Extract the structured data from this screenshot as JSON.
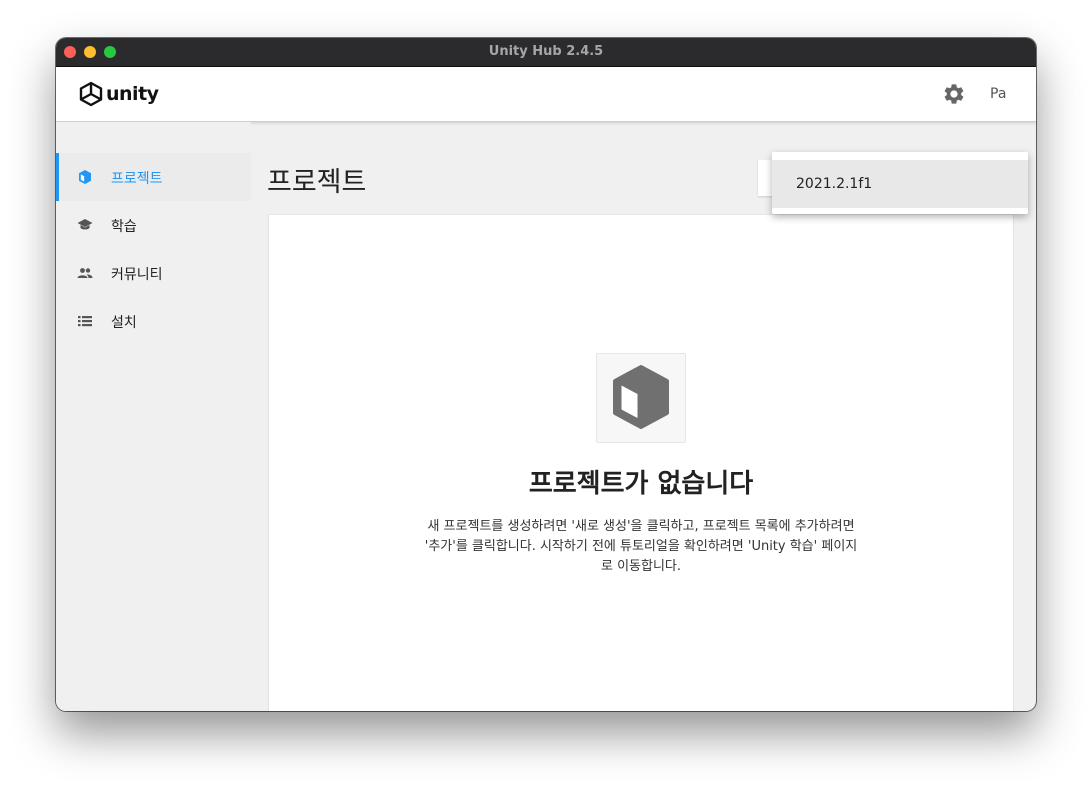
{
  "window": {
    "title": "Unity Hub 2.4.5"
  },
  "header": {
    "logo_text": "unity",
    "account_label": "Pa"
  },
  "sidebar": {
    "items": [
      {
        "label": "프로젝트",
        "icon": "cube-icon"
      },
      {
        "label": "학습",
        "icon": "graduation-cap-icon"
      },
      {
        "label": "커뮤니티",
        "icon": "people-icon"
      },
      {
        "label": "설치",
        "icon": "list-icon"
      }
    ]
  },
  "main": {
    "title": "프로젝트",
    "empty_state": {
      "title": "프로젝트가 없습니다",
      "description": "새 프로젝트를 생성하려면 '새로 생성'을 클릭하고, 프로젝트 목록에 추가하려면 '추가'를 클릭합니다. 시작하기 전에 튜토리얼을 확인하려면 'Unity 학습' 페이지로 이동합니다."
    }
  },
  "dropdown": {
    "items": [
      "2021.2.1f1"
    ]
  },
  "colors": {
    "accent": "#2196f3",
    "titlebar": "#2b2b2e",
    "sidebar_bg": "#f0f0f0"
  }
}
